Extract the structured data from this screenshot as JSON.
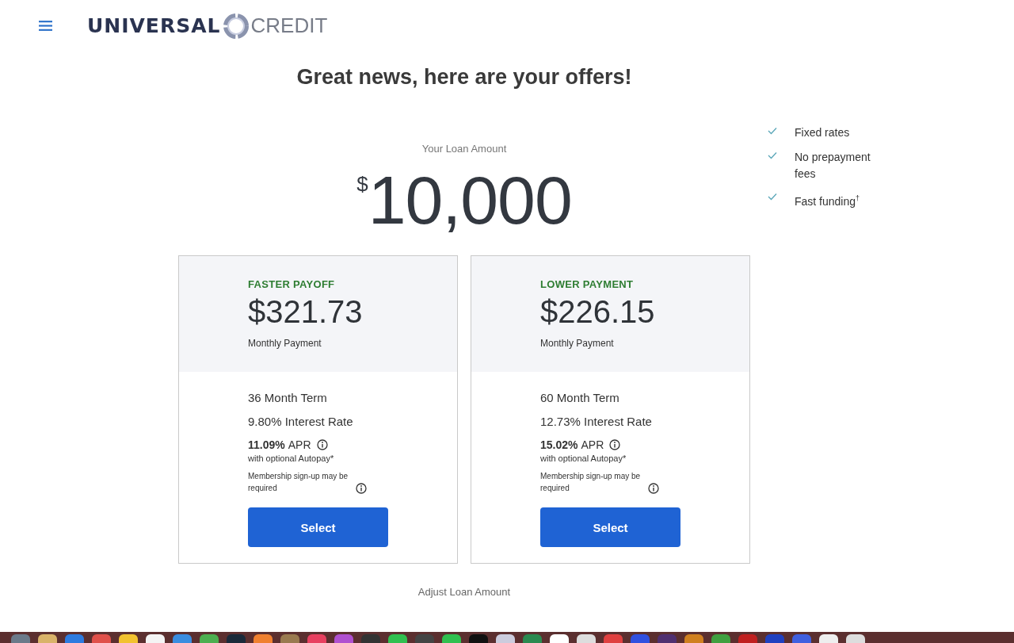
{
  "header": {
    "logo_left": "UNIVERSAL",
    "logo_right": "CREDIT"
  },
  "heading": "Great news, here are your offers!",
  "loan": {
    "label": "Your Loan Amount",
    "currency": "$",
    "amount": "10,000"
  },
  "benefits": [
    "Fixed rates",
    "No prepayment fees",
    "Fast funding$^{†}$"
  ],
  "offers": [
    {
      "tag": "FASTER PAYOFF",
      "payment": "$321.73",
      "payment_label": "Monthly Payment",
      "term": "36 Month Term",
      "rate": "9.80% Interest Rate",
      "apr": "11.09%",
      "apr_label": "APR",
      "autopay": "with optional Autopay*",
      "membership": "Membership sign-up may be required",
      "button": "Select"
    },
    {
      "tag": "LOWER PAYMENT",
      "payment": "$226.15",
      "payment_label": "Monthly Payment",
      "term": "60 Month Term",
      "rate": "12.73% Interest Rate",
      "apr": "15.02%",
      "apr_label": "APR",
      "autopay": "with optional Autopay*",
      "membership": "Membership sign-up may be required",
      "button": "Select"
    }
  ],
  "adjust_link": "Adjust Loan Amount"
}
